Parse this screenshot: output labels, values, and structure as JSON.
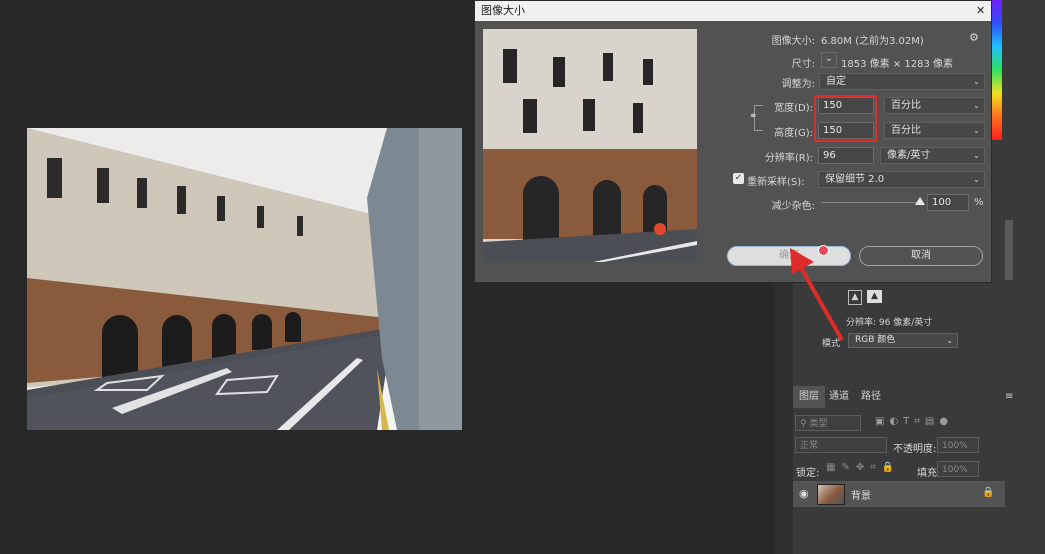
{
  "dialog": {
    "title": "图像大小",
    "image_size_label": "图像大小:",
    "image_size_value": "6.80M (之前为3.02M)",
    "dimensions_label": "尺寸:",
    "dimensions_value": "1853 像素 × 1283 像素",
    "fit_label": "调整为:",
    "fit_value": "自定",
    "width_label": "宽度(D):",
    "width_value": "150",
    "width_unit": "百分比",
    "height_label": "高度(G):",
    "height_value": "150",
    "height_unit": "百分比",
    "resolution_label": "分辨率(R):",
    "resolution_value": "96",
    "resolution_unit": "像素/英寸",
    "resample_label": "重新采样(S):",
    "resample_value": "保留细节 2.0",
    "noise_label": "减少杂色:",
    "noise_value": "100",
    "noise_unit": "%",
    "ok_label": "确定",
    "cancel_label": "取消",
    "close_glyph": "✕",
    "gear_glyph": "⚙",
    "dropdown_glyph": "⌄",
    "resample_checked": true,
    "noise_level": 1.0
  },
  "properties": {
    "resolution_text": "分辨率: 96 像素/英寸",
    "mode_label": "模式",
    "mode_value": "RGB 颜色"
  },
  "layers": {
    "tabs": [
      "图层",
      "通道",
      "路径"
    ],
    "search_placeholder": "类型",
    "blend_mode": "正常",
    "opacity_label": "不透明度:",
    "opacity_value": "100%",
    "lock_label": "锁定:",
    "fill_label": "填充:",
    "fill_value": "100%",
    "layer_name": "背景"
  },
  "colors": {
    "highlight": "#e02b2b",
    "panel": "#3a3a3a",
    "dialog": "#525252"
  }
}
